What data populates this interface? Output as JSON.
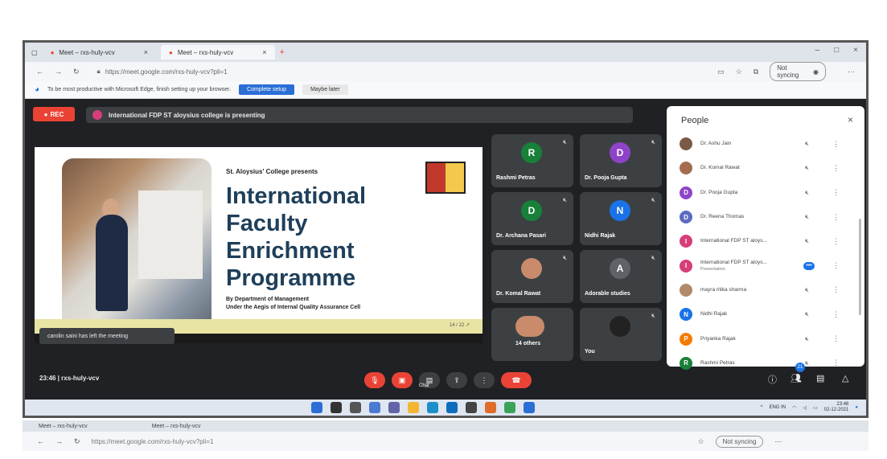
{
  "browser": {
    "tabs": [
      {
        "label": "Meet – rxs-huly-vcv",
        "close": "×"
      },
      {
        "label": "Meet – rxs-huly-vcv",
        "close": "×"
      }
    ],
    "new_tab": "+",
    "window_controls": [
      "–",
      "□",
      "×"
    ],
    "url": "https://meet.google.com/rxs-huly-vcv?pli=1",
    "sync_label": "Not syncing"
  },
  "edge_banner": {
    "text": "To be most productive with Microsoft Edge, finish setting up your browser.",
    "setup_button": "Complete setup",
    "later_button": "Maybe later"
  },
  "meet": {
    "rec_label": "REC",
    "presenting_text": "International FDP ST aloysius college is presenting",
    "slide": {
      "presents": "St. Aloysius' College presents",
      "title_lines": [
        "International",
        "Faculty",
        "Enrichment",
        "Programme"
      ],
      "dept": "By Department of Management",
      "aegis": "Under the Aegis of Internal Quality Assurance Cell",
      "page": "14 / 22 ↗"
    },
    "toast": "carolin saini has left the meeting",
    "tiles": [
      {
        "name": "Rashmi Petras",
        "initial": "R",
        "color": "#188038"
      },
      {
        "name": "Dr. Pooja Gupta",
        "initial": "D",
        "color": "#8e44c9"
      },
      {
        "name": "Dr. Archana Pasari",
        "initial": "D",
        "color": "#188038"
      },
      {
        "name": "Nidhi Rajak",
        "initial": "N",
        "color": "#1a73e8"
      },
      {
        "name": "Dr. Komal Rawat",
        "initial": "",
        "color": "#c98b6b"
      },
      {
        "name": "Adorable studies",
        "initial": "A",
        "color": "#5f6368"
      },
      {
        "name": "14 others",
        "initial": "",
        "color": "#c98b6b"
      },
      {
        "name": "You",
        "initial": "",
        "color": "#222222"
      }
    ],
    "meeting_time": "23:46",
    "meeting_code": "rxs-huly-vcv",
    "chat_label": "Chat",
    "people_count": "21"
  },
  "people_panel": {
    "title": "People",
    "close": "×",
    "participants": [
      {
        "name": "Dr. Ashu Jain",
        "sub": "",
        "initial": "",
        "color": "#7a5a45"
      },
      {
        "name": "Dr. Komal Rawat",
        "sub": "",
        "initial": "",
        "color": "#a46b4f"
      },
      {
        "name": "Dr. Pooja Gupta",
        "sub": "",
        "initial": "D",
        "color": "#8e44c9"
      },
      {
        "name": "Dr. Reena Thomas",
        "sub": "",
        "initial": "D",
        "color": "#5c6bc0"
      },
      {
        "name": "International FDP ST aloys...",
        "sub": "",
        "initial": "I",
        "color": "#d63e7a"
      },
      {
        "name": "International FDP ST aloys...",
        "sub": "Presentation",
        "initial": "I",
        "color": "#d63e7a"
      },
      {
        "name": "mayra ritika sharma",
        "sub": "",
        "initial": "",
        "color": "#b08a6a"
      },
      {
        "name": "Nidhi Rajak",
        "sub": "",
        "initial": "N",
        "color": "#1a73e8"
      },
      {
        "name": "Priyanka Rajak",
        "sub": "",
        "initial": "P",
        "color": "#f57c00"
      },
      {
        "name": "Rashmi Petras",
        "sub": "",
        "initial": "R",
        "color": "#188038"
      }
    ]
  },
  "taskbar": {
    "lang": "ENG IN",
    "time": "23:46",
    "date": "02-12-2021"
  }
}
